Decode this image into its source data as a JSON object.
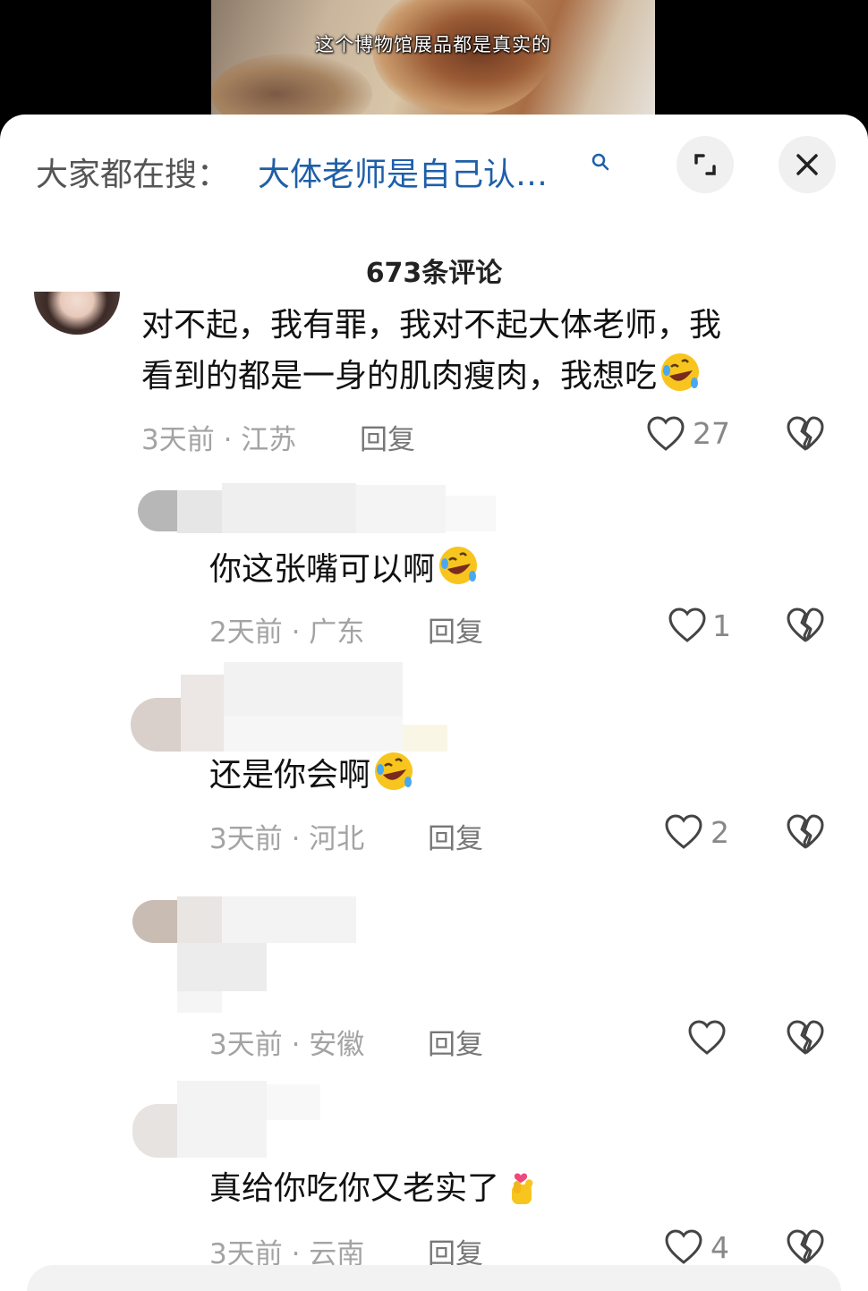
{
  "video": {
    "caption": "这个博物馆展品都是真实的"
  },
  "search": {
    "prefix": "大家都在搜：",
    "query": "大体老师是自己认…"
  },
  "comments_title": "673条评论",
  "comments": [
    {
      "text_line1": "对不起，我有罪，我对不起大体老师，我",
      "text_line2": "看到的都是一身的肌肉瘦肉，我想吃",
      "meta": "3天前 · 江苏",
      "reply": "回复",
      "likes": "27"
    },
    {
      "text": "你这张嘴可以啊",
      "meta": "2天前 · 广东",
      "reply": "回复",
      "likes": "1"
    },
    {
      "text": "还是你会啊",
      "meta": "3天前 · 河北",
      "reply": "回复",
      "likes": "2"
    },
    {
      "text": "",
      "meta": "3天前 · 安徽",
      "reply": "回复",
      "likes": ""
    },
    {
      "text": "真给你吃你又老实了",
      "meta": "3天前 · 云南",
      "reply": "回复",
      "likes": "4"
    }
  ],
  "colors": {
    "query_link": "#1e5fa8",
    "meta_gray": "#a3a3a3",
    "text_dark": "#111111"
  },
  "icons": {
    "search": "search-icon",
    "expand": "expand-icon",
    "close": "close-icon",
    "like": "heart-icon",
    "dislike": "broken-heart-icon",
    "laugh": "rofl-emoji-icon",
    "finger_heart": "finger-heart-emoji-icon"
  }
}
